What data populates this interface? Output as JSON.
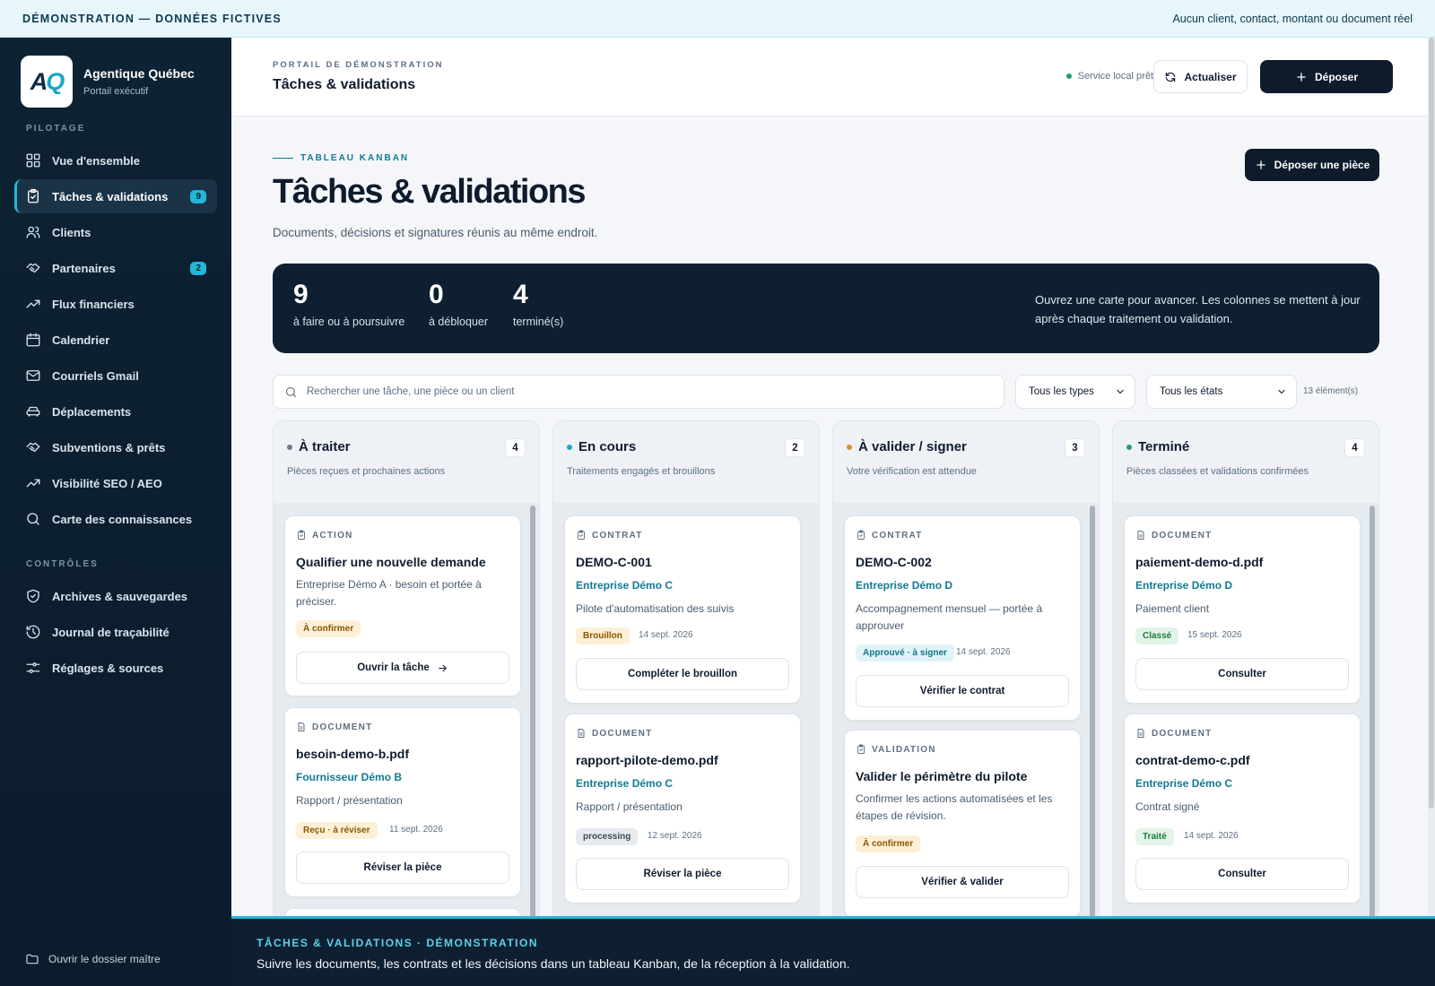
{
  "banner": {
    "left": "DÉMONSTRATION — DONNÉES FICTIVES",
    "right": "Aucun client, contact, montant ou document réel"
  },
  "brand": {
    "name": "Agentique Québec",
    "subtitle": "Portail exécutif",
    "logo_text": "AQ"
  },
  "sidebar": {
    "section1": "PILOTAGE",
    "section2": "CONTRÔLES",
    "items": [
      {
        "label": "Vue d'ensemble",
        "icon": "grid-icon"
      },
      {
        "label": "Tâches & validations",
        "icon": "clipboard-check-icon",
        "badge": "9",
        "active": true
      },
      {
        "label": "Clients",
        "icon": "users-icon"
      },
      {
        "label": "Partenaires",
        "icon": "handshake-icon",
        "badge": "2"
      },
      {
        "label": "Flux financiers",
        "icon": "trending-up-icon"
      },
      {
        "label": "Calendrier",
        "icon": "calendar-icon"
      },
      {
        "label": "Courriels Gmail",
        "icon": "mail-icon"
      },
      {
        "label": "Déplacements",
        "icon": "car-icon"
      },
      {
        "label": "Subventions & prêts",
        "icon": "handshake-icon"
      },
      {
        "label": "Visibilité SEO / AEO",
        "icon": "trending-up-icon"
      },
      {
        "label": "Carte des connaissances",
        "icon": "search-icon"
      }
    ],
    "controls": [
      {
        "label": "Archives & sauvegardes",
        "icon": "shield-icon"
      },
      {
        "label": "Journal de traçabilité",
        "icon": "history-icon"
      },
      {
        "label": "Réglages & sources",
        "icon": "sliders-icon"
      }
    ],
    "footer": "Ouvrir le dossier maître"
  },
  "topbar": {
    "kicker": "PORTAIL DE DÉMONSTRATION",
    "title": "Tâches & validations",
    "service": "Service local prêt",
    "refresh": "Actualiser",
    "deposit": "Déposer",
    "service_color": "#22a06b"
  },
  "main": {
    "kicker": "TABLEAU KANBAN",
    "title": "Tâches & validations",
    "subtitle": "Documents, décisions et signatures réunis au même endroit.",
    "upload": "Déposer une pièce",
    "stats": [
      {
        "value": "9",
        "label": "à faire ou à poursuivre"
      },
      {
        "value": "0",
        "label": "à débloquer"
      },
      {
        "value": "4",
        "label": "terminé(s)"
      }
    ],
    "note": "Ouvrez une carte pour avancer. Les colonnes se mettent à jour après chaque traitement ou validation.",
    "search_placeholder": "Rechercher une tâche, une pièce ou un client",
    "type_filter": "Tous les types",
    "state_filter": "Tous les états",
    "count": "13 élément(s)"
  },
  "columns": [
    {
      "title": "À traiter",
      "count": "4",
      "desc": "Pièces reçues et prochaines actions",
      "dot": "#6b7a89",
      "cards": [
        {
          "type": "ACTION",
          "title": "Qualifier une nouvelle demande",
          "desc": "Entreprise Démo A · besoin et portée à préciser.",
          "status": "À confirmer",
          "button": "Ouvrir la tâche"
        },
        {
          "type": "DOCUMENT",
          "title": "besoin-demo-b.pdf",
          "company": "Fournisseur Démo B",
          "desc": "Rapport / présentation",
          "status": "Reçu · à réviser",
          "date": "11 sept. 2026",
          "button": "Réviser la pièce"
        }
      ]
    },
    {
      "title": "En cours",
      "count": "2",
      "desc": "Traitements engagés et brouillons",
      "dot": "#1aa6c9",
      "cards": [
        {
          "type": "CONTRAT",
          "title": "DEMO-C-001",
          "company": "Entreprise Démo C",
          "desc": "Pilote d'automatisation des suivis",
          "status": "Brouillon",
          "date": "14 sept. 2026",
          "button": "Compléter le brouillon"
        },
        {
          "type": "DOCUMENT",
          "title": "rapport-pilote-demo.pdf",
          "company": "Entreprise Démo C",
          "desc": "Rapport / présentation",
          "status": "processing",
          "date": "12 sept. 2026",
          "button": "Réviser la pièce"
        }
      ]
    },
    {
      "title": "À valider / signer",
      "count": "3",
      "desc": "Votre vérification est attendue",
      "dot": "#d9902a",
      "cards": [
        {
          "type": "CONTRAT",
          "title": "DEMO-C-002",
          "company": "Entreprise Démo D",
          "desc": "Accompagnement mensuel — portée à approuver",
          "status": "Approuvé · à signer",
          "date": "14 sept. 2026",
          "button": "Vérifier le contrat"
        },
        {
          "type": "VALIDATION",
          "title": "Valider le périmètre du pilote",
          "desc": "Confirmer les actions automatisées et les étapes de révision.",
          "status": "À confirmer",
          "button": "Vérifier & valider"
        }
      ]
    },
    {
      "title": "Terminé",
      "count": "4",
      "desc": "Pièces classées et validations confirmées",
      "dot": "#22a06b",
      "cards": [
        {
          "type": "DOCUMENT",
          "title": "paiement-demo-d.pdf",
          "company": "Entreprise Démo D",
          "desc": "Paiement client",
          "status": "Classé",
          "date": "15 sept. 2026",
          "button": "Consulter"
        },
        {
          "type": "DOCUMENT",
          "title": "contrat-demo-c.pdf",
          "company": "Entreprise Démo C",
          "desc": "Contrat signé",
          "status": "Traité",
          "date": "14 sept. 2026",
          "button": "Consulter"
        }
      ]
    }
  ],
  "footer": {
    "kicker": "TÂCHES & VALIDATIONS · DÉMONSTRATION",
    "text": "Suivre les documents, les contrats et les décisions dans un tableau Kanban, de la réception à la validation."
  }
}
